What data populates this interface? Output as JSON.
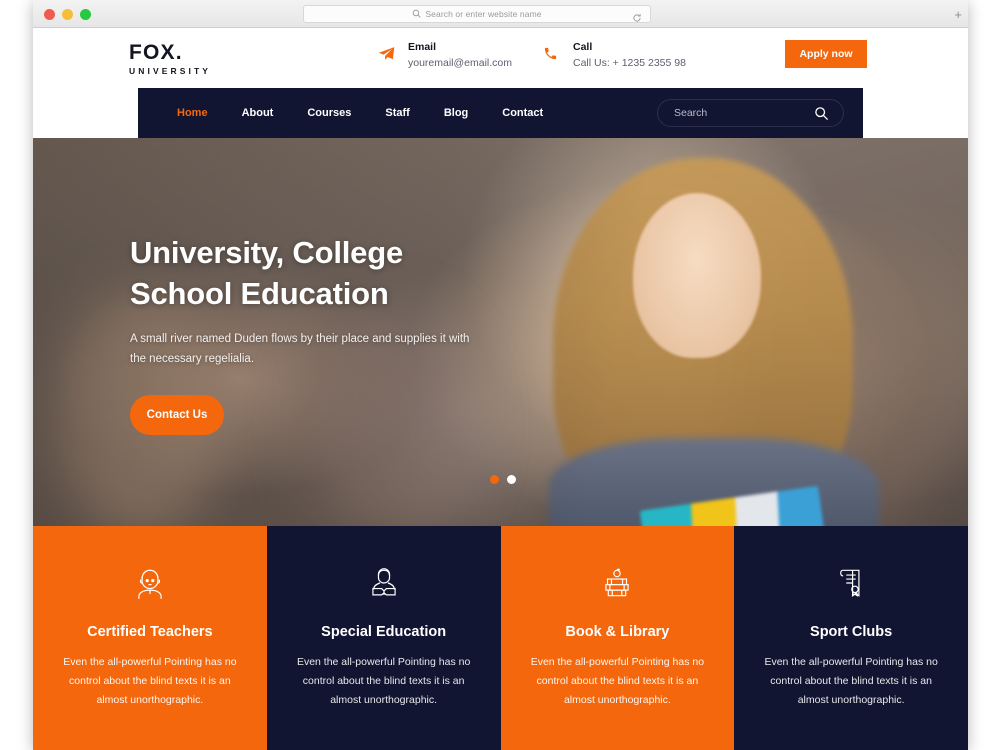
{
  "browser": {
    "address_placeholder": "Search or enter website name",
    "search_icon": "search-icon",
    "reload_icon": "reload-icon",
    "new_tab_label": "+",
    "traffic_lights": [
      "close",
      "minimize",
      "maximize"
    ]
  },
  "header": {
    "logo": {
      "main": "FOX.",
      "sub": "UNIVERSITY"
    },
    "contacts": [
      {
        "icon": "paper-plane-icon",
        "label": "Email",
        "value": "youremail@email.com",
        "name": "contact-email"
      },
      {
        "icon": "phone-icon",
        "label": "Call",
        "value": "Call Us: + 1235 2355 98",
        "name": "contact-call"
      }
    ],
    "apply_button": "Apply now"
  },
  "nav": {
    "items": [
      {
        "label": "Home",
        "active": true
      },
      {
        "label": "About",
        "active": false
      },
      {
        "label": "Courses",
        "active": false
      },
      {
        "label": "Staff",
        "active": false
      },
      {
        "label": "Blog",
        "active": false
      },
      {
        "label": "Contact",
        "active": false
      }
    ],
    "search_placeholder": "Search",
    "search_icon": "search-icon"
  },
  "hero": {
    "title_line1": "University, College",
    "title_line2": "School Education",
    "subtitle": "A small river named Duden flows by their place and supplies it with the necessary regelialia.",
    "cta_label": "Contact Us",
    "slider_dots": [
      {
        "state": "inactive",
        "color": "#f4670c"
      },
      {
        "state": "active",
        "color": "#ffffff"
      }
    ]
  },
  "features": [
    {
      "icon": "teacher-avatar-icon",
      "title": "Certified Teachers",
      "desc": "Even the all-powerful Pointing has no control about the blind texts it is an almost unorthographic.",
      "theme": "orange"
    },
    {
      "icon": "student-reading-icon",
      "title": "Special Education",
      "desc": "Even the all-powerful Pointing has no control about the blind texts it is an almost unorthographic.",
      "theme": "navy"
    },
    {
      "icon": "books-apple-icon",
      "title": "Book & Library",
      "desc": "Even the all-powerful Pointing has no control about the blind texts it is an almost unorthographic.",
      "theme": "orange"
    },
    {
      "icon": "certificate-icon",
      "title": "Sport Clubs",
      "desc": "Even the all-powerful Pointing has no control about the blind texts it is an almost unorthographic.",
      "theme": "navy"
    }
  ],
  "colors": {
    "accent_orange": "#f4670c",
    "dark_navy": "#111531",
    "text_dark": "#14161f",
    "text_muted": "#5c6070"
  }
}
